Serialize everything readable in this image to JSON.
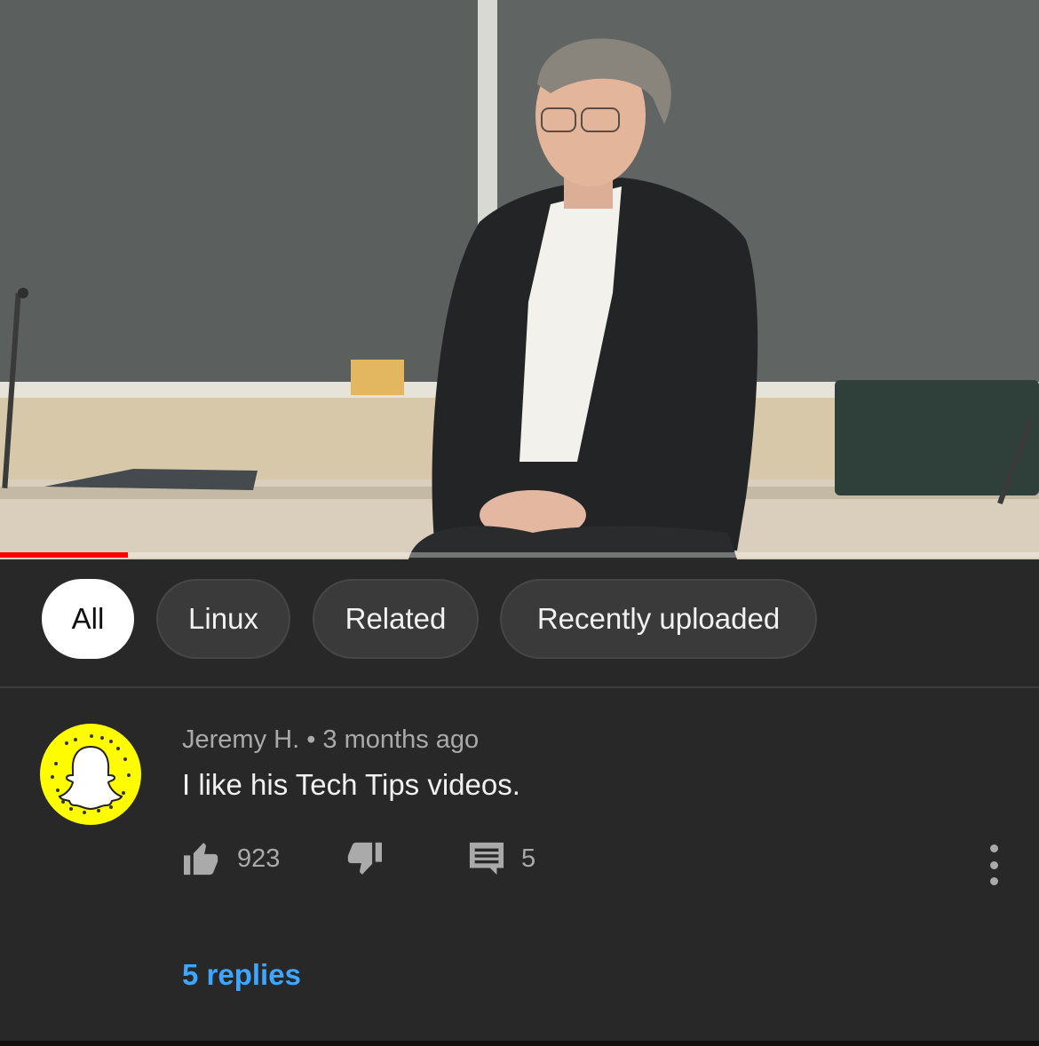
{
  "video": {
    "progress_fraction": 0.123
  },
  "chips": [
    {
      "label": "All",
      "active": true
    },
    {
      "label": "Linux",
      "active": false
    },
    {
      "label": "Related",
      "active": false
    },
    {
      "label": "Recently uploaded",
      "active": false
    }
  ],
  "comment": {
    "author": "Jeremy H.",
    "separator": "•",
    "time": "3 months ago",
    "text": "I like his Tech Tips videos.",
    "likes": "923",
    "replies_count": "5",
    "replies_link": "5 replies",
    "avatar_icon": "snapchat-ghost-icon"
  },
  "colors": {
    "background": "#282828",
    "chip_bg": "#3a3a3a",
    "chip_active_bg": "#ffffff",
    "progress": "#ff0000",
    "link": "#3ea6ff",
    "secondary_text": "#aaaaaa",
    "avatar_bg": "#fffc00"
  },
  "icons": {
    "like": "thumbs-up-icon",
    "dislike": "thumbs-down-icon",
    "reply": "comment-icon",
    "more": "more-vert-icon"
  }
}
